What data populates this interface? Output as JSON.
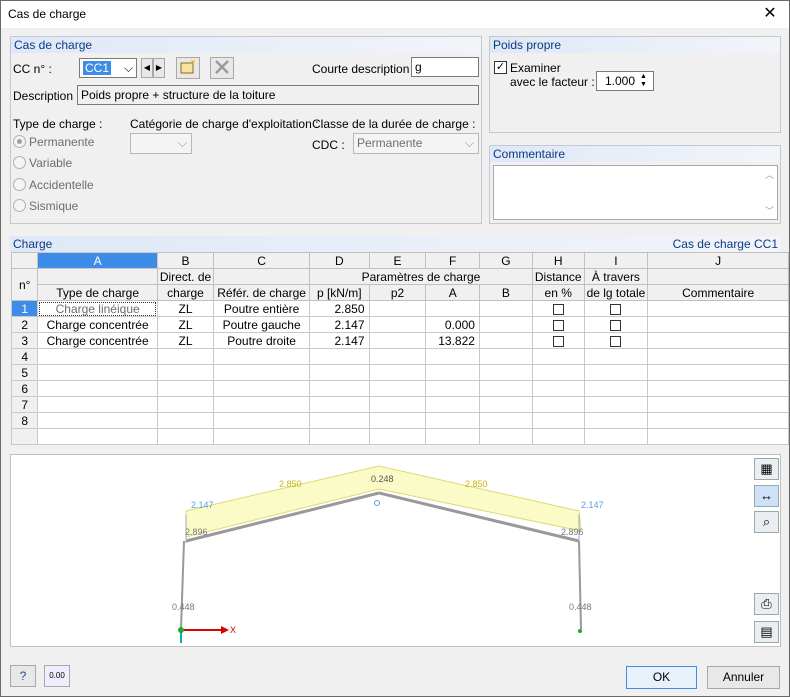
{
  "window": {
    "title": "Cas de charge",
    "close_glyph": "✕"
  },
  "cas": {
    "header": "Cas de charge",
    "cc_label": "CC n° :",
    "cc_value": "CC1",
    "short_desc_label": "Courte description :",
    "short_desc_value": "g",
    "desc_label": "Description :",
    "desc_value": "Poids propre + structure de la toiture"
  },
  "type": {
    "label": "Type de charge :",
    "options": [
      "Permanente",
      "Variable",
      "Accidentelle",
      "Sismique"
    ],
    "selected": "Permanente"
  },
  "categorie": {
    "label": "Catégorie de charge d'exploitation :"
  },
  "classe": {
    "label": "Classe de la durée de charge :",
    "cdc_label": "CDC :",
    "cdc_value": "Permanente"
  },
  "poids": {
    "header": "Poids propre",
    "examiner": "Examiner",
    "facteur_label": "avec le facteur :",
    "facteur_value": "1.000"
  },
  "commentaire": {
    "header": "Commentaire"
  },
  "charge": {
    "header": "Charge",
    "right_title": "Cas de charge CC1",
    "col_letters": [
      "A",
      "B",
      "C",
      "D",
      "E",
      "F",
      "G",
      "H",
      "I",
      "J"
    ],
    "hdr_row1": {
      "b": "Direct. de",
      "params": "Paramètres de charge",
      "h": "Distance",
      "i": "À travers"
    },
    "hdr_row2": {
      "n": "n°",
      "a": "Type de charge",
      "b": "charge",
      "c": "Référ. de charge",
      "d": "p [kN/m]",
      "e": "p2",
      "f": "A",
      "g": "B",
      "h": "en %",
      "i": "de lg totale",
      "j": "Commentaire"
    },
    "rows": [
      {
        "n": "1",
        "a": "Charge linéique",
        "b": "ZL",
        "c": "Poutre entière",
        "d": "2.850",
        "e": "",
        "f": "",
        "g": ""
      },
      {
        "n": "2",
        "a": "Charge concentrée",
        "b": "ZL",
        "c": "Poutre gauche",
        "d": "2.147",
        "e": "",
        "f": "0.000",
        "g": ""
      },
      {
        "n": "3",
        "a": "Charge concentrée",
        "b": "ZL",
        "c": "Poutre droite",
        "d": "2.147",
        "e": "",
        "f": "13.822",
        "g": ""
      },
      {
        "n": "4"
      },
      {
        "n": "5"
      },
      {
        "n": "6"
      },
      {
        "n": "7"
      },
      {
        "n": "8"
      }
    ]
  },
  "graphic": {
    "labels": {
      "ridge": "0.248",
      "load_left": "2.850",
      "load_right": "2.850",
      "pt_left": "2.147",
      "pt_right": "2.147",
      "knee_left": "2.896",
      "knee_right": "2.896",
      "col_left": "0.448",
      "col_right": "0.448",
      "axis_x": "X"
    }
  },
  "footer": {
    "ok": "OK",
    "cancel": "Annuler",
    "units_icon_text": "0.00"
  }
}
